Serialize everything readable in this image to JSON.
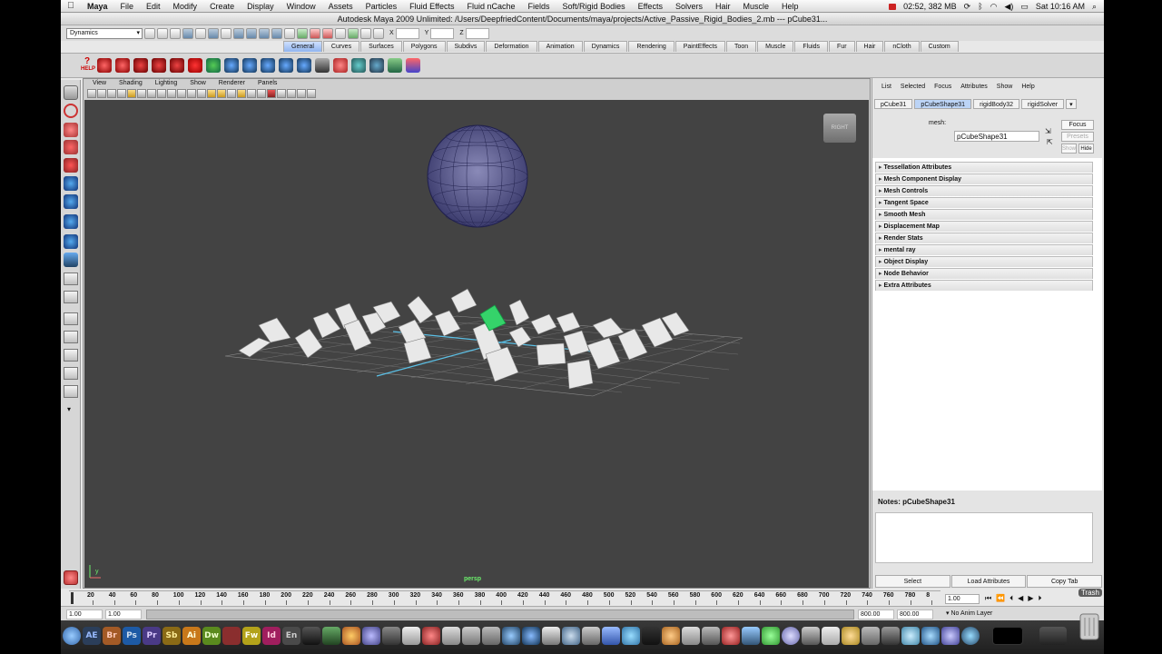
{
  "menubar": {
    "app_name": "Maya",
    "items": [
      "File",
      "Edit",
      "Modify",
      "Create",
      "Display",
      "Window",
      "Assets",
      "Particles",
      "Fluid Effects",
      "Fluid nCache",
      "Fields",
      "Soft/Rigid Bodies",
      "Effects",
      "Solvers",
      "Hair",
      "Muscle",
      "Help"
    ],
    "status_time_mem": "02:52, 382 MB",
    "clock": "Sat 10:16 AM"
  },
  "window": {
    "title": "Autodesk Maya 2009 Unlimited: /Users/DeepfriedContent/Documents/maya/projects/Active_Passive_Rigid_Bodies_2.mb  ---  pCube31..."
  },
  "statusline": {
    "menuset": "Dynamics",
    "x_label": "X",
    "y_label": "Y",
    "z_label": "Z"
  },
  "shelf": {
    "tabs": [
      "General",
      "Curves",
      "Surfaces",
      "Polygons",
      "Subdivs",
      "Deformation",
      "Animation",
      "Dynamics",
      "Rendering",
      "PaintEffects",
      "Toon",
      "Muscle",
      "Fluids",
      "Fur",
      "Hair",
      "nCloth",
      "Custom"
    ],
    "active_tab": "General",
    "help_label": "HELP"
  },
  "panel": {
    "menus": [
      "View",
      "Shading",
      "Lighting",
      "Show",
      "Renderer",
      "Panels"
    ],
    "camera_label": "persp",
    "viewcube_label": "RIGHT",
    "axis_y": "y"
  },
  "attribute_editor": {
    "menus": [
      "List",
      "Selected",
      "Focus",
      "Attributes",
      "Show",
      "Help"
    ],
    "tabs": [
      "pCube31",
      "pCubeShape31",
      "rigidBody32",
      "rigidSolver"
    ],
    "active_tab": "pCubeShape31",
    "mesh_label": "mesh:",
    "mesh_value": "pCubeShape31",
    "focus_btn": "Focus",
    "presets_btn": "Presets",
    "show_btn": "Show",
    "hide_btn": "Hide",
    "sections": [
      "Tessellation Attributes",
      "Mesh Component Display",
      "Mesh Controls",
      "Tangent Space",
      "Smooth Mesh",
      "Displacement Map",
      "Render Stats",
      "mental ray",
      "Object Display",
      "Node Behavior",
      "Extra Attributes"
    ],
    "notes_label": "Notes:  pCubeShape31",
    "bottom_buttons": [
      "Select",
      "Load Attributes",
      "Copy Tab"
    ]
  },
  "timeline": {
    "ticks": [
      "20",
      "40",
      "60",
      "80",
      "100",
      "120",
      "140",
      "160",
      "180",
      "200",
      "220",
      "240",
      "260",
      "280",
      "300",
      "320",
      "340",
      "360",
      "380",
      "400",
      "420",
      "440",
      "460",
      "480",
      "500",
      "520",
      "540",
      "560",
      "580",
      "600",
      "620",
      "640",
      "660",
      "680",
      "700",
      "720",
      "740",
      "760",
      "780",
      "8"
    ],
    "current_frame": "1.00",
    "range_start": "1.00",
    "range_inner_start": "1.00",
    "range_inner_end": "800.00",
    "range_end": "800.00",
    "anim_layer": "No Anim Layer"
  },
  "dock": {
    "trash_label": "Trash",
    "apps": [
      "AE",
      "Br",
      "Ps",
      "Pr",
      "Sb",
      "Ai",
      "Dw",
      "Fw",
      "Id",
      "En"
    ]
  }
}
